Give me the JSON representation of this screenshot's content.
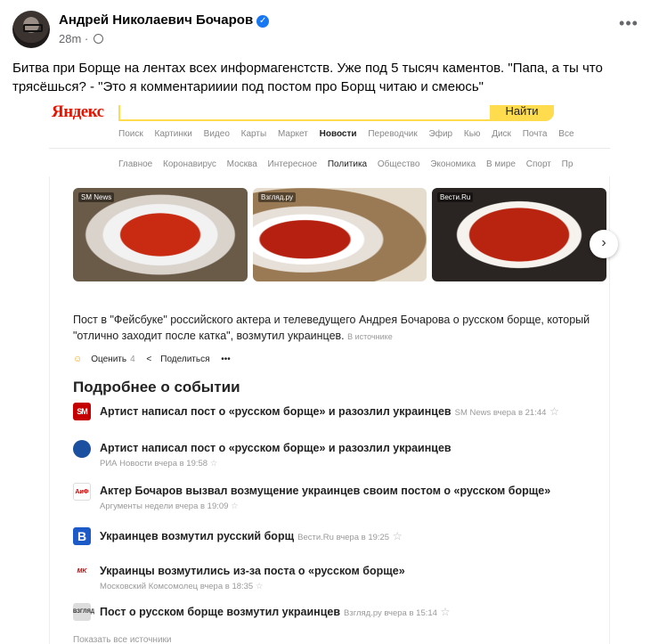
{
  "post": {
    "author": "Андрей Николаевич Бочаров",
    "time": "28m",
    "more": "•••",
    "text": "Битва при Борще на лентах всех информагенстств. Уже под 5 тысяч каментов. \"Папа, а ты что трясёшься? - \"Это я комментарииии под постом про Борщ читаю и смеюсь\""
  },
  "yandex": {
    "logo": "Яндекс",
    "search_button": "Найти",
    "nav_main": [
      "Поиск",
      "Картинки",
      "Видео",
      "Карты",
      "Маркет",
      "Новости",
      "Переводчик",
      "Эфир",
      "Кью",
      "Диск",
      "Почта",
      "Все"
    ],
    "nav_main_active": "Новости",
    "nav_news": [
      "Главное",
      "Коронавирус",
      "Москва",
      "Интересное",
      "Политика",
      "Общество",
      "Экономика",
      "В мире",
      "Спорт",
      "Пр"
    ],
    "nav_news_active": "Политика"
  },
  "story": {
    "photos": [
      {
        "source": "SM News"
      },
      {
        "source": "Взгляд.ру"
      },
      {
        "source": "Вести.Ru"
      }
    ],
    "next_arrow": "›",
    "lead": "Пост в \"Фейсбуке\" российского актера и телеведущего Андрея Бочарова о русском борще, который \"отлично заходит после катка\", возмутил украинцев.",
    "lead_source": "В источнике",
    "rate_label": "Оценить",
    "rate_count": "4",
    "share_label": "Поделиться",
    "more": "•••",
    "section_title": "Подробнее о событии",
    "items": [
      {
        "logo": "SM",
        "headline": "Артист написал пост о «русском борще» и разозлил украинцев",
        "inline_meta": "SM News вчера в 21:44",
        "sub": ""
      },
      {
        "logo": "",
        "headline": "Артист написал пост о «русском борще» и разозлил украинцев",
        "inline_meta": "",
        "sub": "РИА Новости вчера в 19:58"
      },
      {
        "logo": "АиФ",
        "headline": "Актер Бочаров вызвал возмущение украинцев своим постом о «русском борще»",
        "inline_meta": "",
        "sub": "Аргументы недели вчера в 19:09"
      },
      {
        "logo": "B",
        "headline": "Украинцев возмутил русский борщ",
        "inline_meta": "Вести.Ru вчера в 19:25",
        "sub": ""
      },
      {
        "logo": "MK",
        "headline": "Украинцы возмутились из-за поста о «русском борще»",
        "inline_meta": "",
        "sub": "Московский Комсомолец вчера в 18:35"
      },
      {
        "logo": "ВЗГЛЯД",
        "headline": "Пост о русском борще возмутил украинцев",
        "inline_meta": "Взгляд.ру вчера в 15:14",
        "sub": ""
      }
    ],
    "show_all": "Показать все источники"
  }
}
